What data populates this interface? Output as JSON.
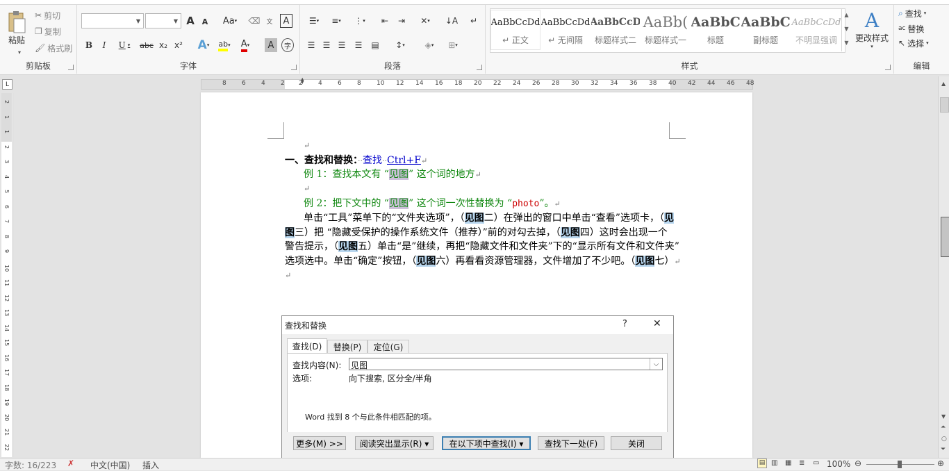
{
  "ribbon": {
    "clipboard": {
      "paste": "粘贴",
      "cut": "剪切",
      "copy": "复制",
      "format_painter": "格式刷",
      "label": "剪贴板"
    },
    "font": {
      "grow": "A",
      "shrink": "A",
      "change_case": "Aa",
      "bold": "B",
      "italic": "I",
      "underline": "U",
      "strike": "abc",
      "subscript": "x₂",
      "superscript": "x²",
      "label": "字体"
    },
    "paragraph": {
      "label": "段落"
    },
    "styles": {
      "label": "样式",
      "items": [
        {
          "preview": "AaBbCcDd",
          "name": "↵ 正文"
        },
        {
          "preview": "AaBbCcDd",
          "name": "↵ 无间隔"
        },
        {
          "preview": "AaBbCcD",
          "name": "标题样式二"
        },
        {
          "preview": "AaBb(",
          "name": "标题样式一"
        },
        {
          "preview": "AaBbC",
          "name": "标题"
        },
        {
          "preview": "AaBbC",
          "name": "副标题"
        },
        {
          "preview": "AaBbCcDd",
          "name": "不明显强调"
        }
      ],
      "change_styles": "更改样式"
    },
    "editing": {
      "find": "查找",
      "replace": "替换",
      "select": "选择",
      "label": "编辑"
    }
  },
  "ruler": {
    "h_ticks": [
      "8",
      "6",
      "4",
      "2",
      "2",
      "4",
      "6",
      "8",
      "10",
      "12",
      "14",
      "16",
      "18",
      "20",
      "22",
      "24",
      "26",
      "28",
      "30",
      "32",
      "34",
      "36",
      "38",
      "40",
      "42",
      "44",
      "46",
      "48"
    ],
    "v_ticks": [
      "2",
      "1",
      "1",
      "2",
      "3",
      "4",
      "5",
      "6",
      "7",
      "8",
      "9",
      "10",
      "11",
      "12",
      "13",
      "14",
      "15",
      "16",
      "17",
      "18",
      "19",
      "20",
      "21",
      "22"
    ]
  },
  "doc": {
    "empty_mark": "↵",
    "h1_num": "一、",
    "h1_title": "查找和替换：",
    "h1_find": "查找",
    "h1_shortcut": "Ctrl+F",
    "ex1_pre": "例 1：查找本文有 “",
    "ex1_term": "见图",
    "ex1_post": "” 这个词的地方",
    "ex2_pre": "例 2：把下文中的 “",
    "ex2_term": "见图",
    "ex2_mid": "” 这个词一次性替换为 “",
    "ex2_photo": "photo",
    "ex2_post": "”。",
    "p1a": "单击“工具”菜单下的“文件夹选项”，（",
    "p1_hl1": "见图",
    "p1b": "二）在弹出的窗口中单击“查看”选项卡，（",
    "p1_hl2": "见",
    "p2_hl": "图",
    "p2a": "三）把 “隐藏受保护的操作系统文件（推荐）”前的对勾去掉，（",
    "p2_hl2": "见图",
    "p2b": "四）这时会出现一个",
    "p3a": "警告提示，（",
    "p3_hl": "见图",
    "p3b": "五）单击“是”继续，再把“隐藏文件和文件夹”下的“显示所有文件和文件夹”",
    "p4a": "选项选中。单击“确定”按钮，（",
    "p4_hl": "见图",
    "p4b": "六）再看看资源管理器，文件增加了不少吧。（",
    "p4_hl2": "见图",
    "p4c": "七）"
  },
  "dialog": {
    "title": "查找和替换",
    "help": "?",
    "close": "✕",
    "tabs": [
      "查找(D)",
      "替换(P)",
      "定位(G)"
    ],
    "find_label": "查找内容(N):",
    "find_value": "见图",
    "options_label": "选项:",
    "options_value": "向下搜索, 区分全/半角",
    "result": "Word 找到 8 个与此条件相匹配的项。",
    "btn_more": "更多(M) >>",
    "btn_reading_highlight": "阅读突出显示(R) ▾",
    "btn_find_in": "在以下项中查找(I) ▾",
    "btn_find_next": "查找下一处(F)",
    "btn_close": "关闭"
  },
  "status": {
    "words": "字数: 16/223",
    "language": "中文(中国)",
    "mode": "插入",
    "zoom": "100%"
  }
}
